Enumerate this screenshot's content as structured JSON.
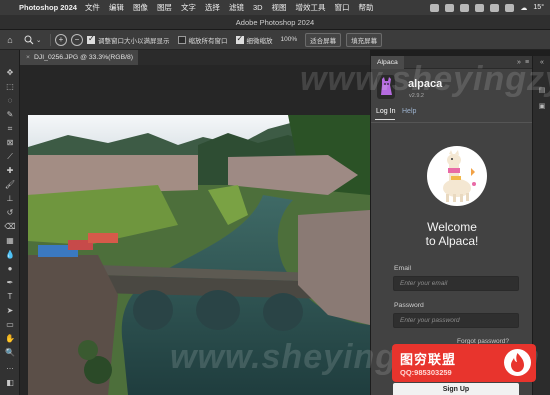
{
  "menubar": {
    "app_name": "Photoshop 2024",
    "items": [
      "文件",
      "编辑",
      "图像",
      "图层",
      "文字",
      "选择",
      "滤镜",
      "3D",
      "视图",
      "增效工具",
      "窗口",
      "帮助"
    ],
    "temperature": "15°"
  },
  "window": {
    "title": "Adobe Photoshop 2024"
  },
  "options": {
    "resize_windows_label": "调整窗口大小以满屏显示",
    "resize_windows_checked": true,
    "zoom_all_windows_label": "缩放所有窗口",
    "zoom_all_windows_checked": false,
    "scrubby_zoom_label": "细微缩放",
    "scrubby_zoom_checked": true,
    "zoom_percent": "100%",
    "fit_screen_label": "适合屏幕",
    "fill_screen_label": "填充屏幕"
  },
  "document": {
    "tab_label": "DJI_0256.JPG @ 33.3%(RGB/8)",
    "close_symbol": "×"
  },
  "panel": {
    "tab_label": "Alpaca",
    "collapse_symbol": "»",
    "menu_symbol": "≡",
    "name": "alpaca",
    "version": "v2.9.2",
    "tabs": [
      "Log In",
      "Help"
    ],
    "welcome_line1": "Welcome",
    "welcome_line2": "to Alpaca!",
    "email_label": "Email",
    "email_placeholder": "Enter your email",
    "password_label": "Password",
    "password_placeholder": "Enter your password",
    "forgot_label": "Forgot password?",
    "signup_label": "Sign Up"
  },
  "watermark": {
    "text": "www.sheyingzyg.com",
    "badge_title": "图穷联盟",
    "badge_sub": "QQ:985303259"
  },
  "colors": {
    "accent_red": "#e8342d",
    "panel_bg": "#424242",
    "link_blue": "#9db3cf"
  }
}
